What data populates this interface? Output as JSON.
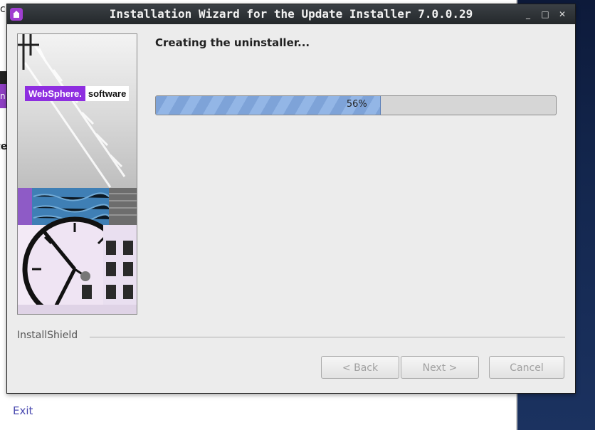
{
  "window": {
    "title": "Installation Wizard for the Update Installer 7.0.0.29",
    "controls": {
      "minimize": "_",
      "maximize": "□",
      "close": "✕"
    },
    "icon": "installer-icon"
  },
  "artwork": {
    "brand": "WebSphere.",
    "suffix": "software"
  },
  "main": {
    "status": "Creating the uninstaller...",
    "progress": {
      "percent": 56,
      "label": "56%",
      "fill_color": "#7ea3d8"
    }
  },
  "footer": {
    "brand": "InstallShield"
  },
  "buttons": {
    "back": "< Back",
    "next": "Next >",
    "cancel": "Cancel"
  },
  "background": {
    "exit_link": "Exit",
    "fragment_top": "c",
    "fragment_mid": "n",
    "fragment_low": "te"
  },
  "colors": {
    "accent": "#8e2ee0",
    "titlebar": "#2d3236",
    "progress": "#7ea3d8"
  }
}
